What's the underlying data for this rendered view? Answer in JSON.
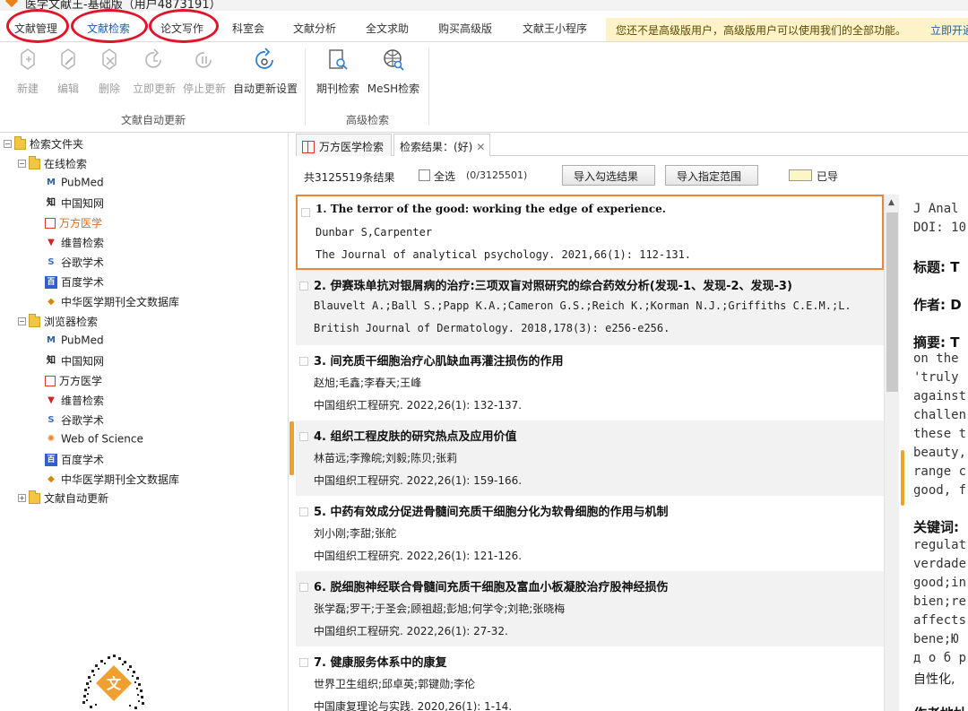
{
  "window": {
    "title": "医学文献王-基础版（用户4873191）"
  },
  "menu": {
    "items": [
      "文献管理",
      "文献检索",
      "论文写作",
      "科室会",
      "文献分析",
      "全文求助",
      "购买高级版",
      "文献王小程序"
    ],
    "notice": "您还不是高级版用户，高级版用户可以使用我们的全部功能。",
    "notice_link": "立即开通"
  },
  "ribbon": {
    "buttons": [
      "新建",
      "编辑",
      "删除",
      "立即更新",
      "停止更新",
      "自动更新设置",
      "期刊检索",
      "MeSH检索"
    ],
    "groups": [
      "文献自动更新",
      "高级检索"
    ]
  },
  "tree": {
    "root": "检索文件夹",
    "online": "在线检索",
    "online_items": [
      "PubMed",
      "中国知网",
      "万方医学",
      "维普检索",
      "谷歌学术",
      "百度学术",
      "中华医学期刊全文数据库"
    ],
    "browser": "浏览器检索",
    "browser_items": [
      "PubMed",
      "中国知网",
      "万方医学",
      "维普检索",
      "谷歌学术",
      "Web of Science",
      "百度学术",
      "中华医学期刊全文数据库"
    ],
    "auto_update": "文献自动更新"
  },
  "tabs": [
    "万方医学检索",
    "检索结果：(好)"
  ],
  "toolbar": {
    "count": "共3125519条结果",
    "select_all": "全选",
    "selected": "(0/3125501)",
    "export_checked": "导入勾选结果",
    "export_range": "导入指定范围",
    "read_label": "已导"
  },
  "results": [
    {
      "title": "1.  The terror of the good: working the edge of experience.",
      "authors": "Dunbar S,Carpenter",
      "source": "The Journal of analytical psychology. 2021,66(1): 112-131."
    },
    {
      "title": "2.  伊赛珠单抗对银屑病的治疗:三项双盲对照研究的综合药效分析(发现-1、发现-2、发现-3)",
      "authors": "Blauvelt A.;Ball S.;Papp K.A.;Cameron G.S.;Reich K.;Korman N.J.;Griffiths C.E.M.;L.",
      "source": "British Journal of Dermatology. 2018,178(3): e256-e256."
    },
    {
      "title": "3.  间充质干细胞治疗心肌缺血再灌注损伤的作用",
      "authors": "赵旭;毛鑫;李春天;王峰",
      "source": "中国组织工程研究. 2022,26(1): 132-137."
    },
    {
      "title": "4.  组织工程皮肤的研究热点及应用价值",
      "authors": "林苗远;李豫皖;刘毅;陈贝;张莉",
      "source": "中国组织工程研究. 2022,26(1): 159-166."
    },
    {
      "title": "5.  中药有效成分促进骨髓间充质干细胞分化为软骨细胞的作用与机制",
      "authors": "刘小刚;李甜;张舵",
      "source": "中国组织工程研究. 2022,26(1): 121-126."
    },
    {
      "title": "6.  脱细胞神经联合骨髓间充质干细胞及富血小板凝胶治疗股神经损伤",
      "authors": "张学磊;罗干;于圣会;顾祖超;彭旭;何学令;刘艳;张晓梅",
      "source": "中国组织工程研究. 2022,26(1): 27-32."
    },
    {
      "title": "7.  健康服务体系中的康复",
      "authors": "世界卫生组织;邱卓英;郭键勋;李伦",
      "source": "中国康复理论与实践. 2020,26(1): 1-14."
    }
  ],
  "detail": {
    "journal": "J Anal",
    "doi": "DOI: 10",
    "title_label": "标题: T",
    "author_label": "作者: D",
    "abstract_label": "摘要: T",
    "abstract_lines": [
      "on the",
      "'truly",
      "against",
      "challen",
      "these t",
      "beauty,",
      "range c",
      "good, f"
    ],
    "keywords_label": "关键词:",
    "keyword_lines": [
      "regulat",
      "verdade",
      "good;in",
      "bien;re",
      "affects",
      "bene;Ю",
      "д о б р",
      "自性化,"
    ],
    "addr_label": "作者地址"
  },
  "colors": {
    "accent": "#e8863a",
    "circle": "#e0152a",
    "link": "#1a5fb4",
    "notice_bg": "#fdf2c8"
  }
}
